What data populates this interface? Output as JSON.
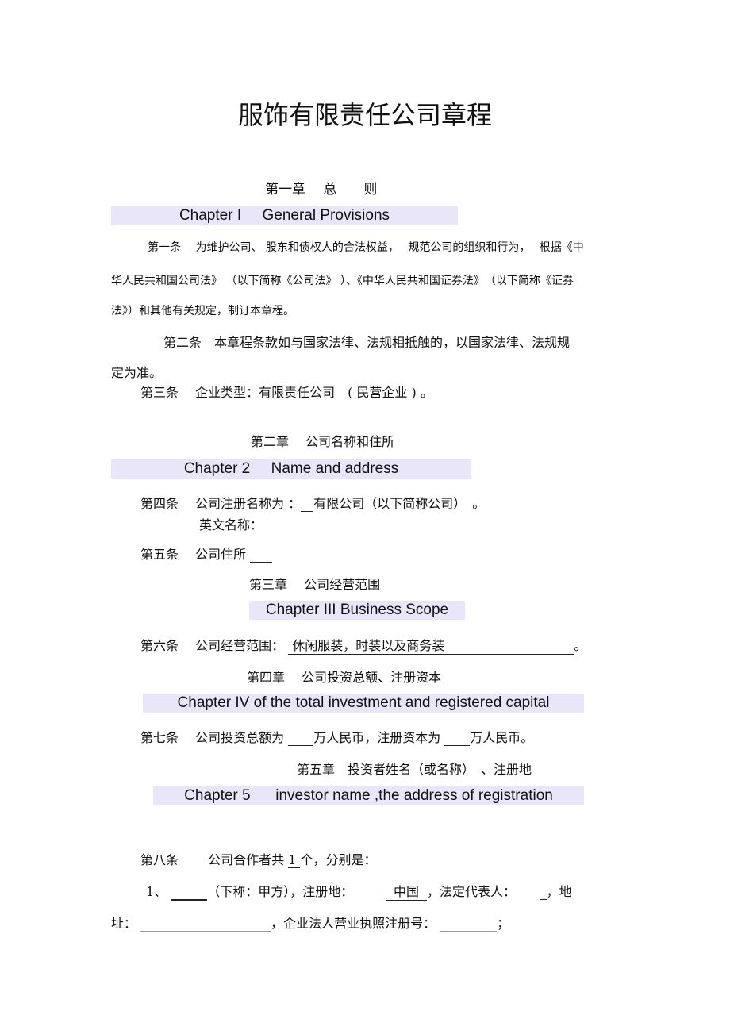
{
  "title": "服饰有限责任公司章程",
  "chapters": [
    {
      "cn": "第一章　 总　　则",
      "en": "Chapter I     General Provisions"
    },
    {
      "cn": "第二章　 公司名称和住所",
      "en": "Chapter 2     Name and address"
    },
    {
      "cn": "第三章　 公司经营范围",
      "en": "Chapter III Business Scope"
    },
    {
      "cn": "第四章　 公司投资总额、注册资本",
      "en": "Chapter IV of the total investment and registered capital"
    },
    {
      "cn": "第五章　投资者姓名（或名称）　、注册地",
      "en": "Chapter 5      investor name ,the address of registration"
    }
  ],
  "articles": {
    "a1_l1": "第一条　 为维护公司、 股东和债权人的合法权益，　 规范公司的组织和行为，　 根据《中",
    "a1_l2": "华人民共和国公司法》 （以下简称《公司法》 ）、《中华人民共和国证券法》　（以下简称《证券",
    "a1_l3": "法》）和其他有关规定，制订本章程。",
    "a2_l1": "第二条　本章程条款如与国家法律、法规相抵触的，以国家法律、法规规",
    "a2_l2": "定为准。",
    "a3": "第三条　 企业类型：有限责任公司　( 民营企业 ) 。",
    "a4_l1": "第四条　 公司注册名称为 ：",
    "a4_l1b": "有限公司（以下简称公司）　。",
    "a4_l2": "英文名称：",
    "a5": "第五条　 公司住所",
    "a6": "第六条　 公司经营范围：",
    "a6_value": " 休闲服装，时装以及商务装",
    "a6_end": "。",
    "a7_a": "第七条　 公司投资总额为",
    "a7_b": "万人民币，注册资本为",
    "a7_c": "万人民币。",
    "a8": "第八条　　 公司合作者共",
    "a8_count": "1",
    "a8_end": "个，分别是：",
    "p1_num": "1、",
    "p1_a": "（下称：甲方），注册地：",
    "p1_country": "中国",
    "p1_b": "，法定代表人：",
    "p1_c": "，地",
    "p1_l2a": "址：",
    "p1_l2b": "，企业法人营业执照注册号：",
    "p1_l2c": "；"
  }
}
